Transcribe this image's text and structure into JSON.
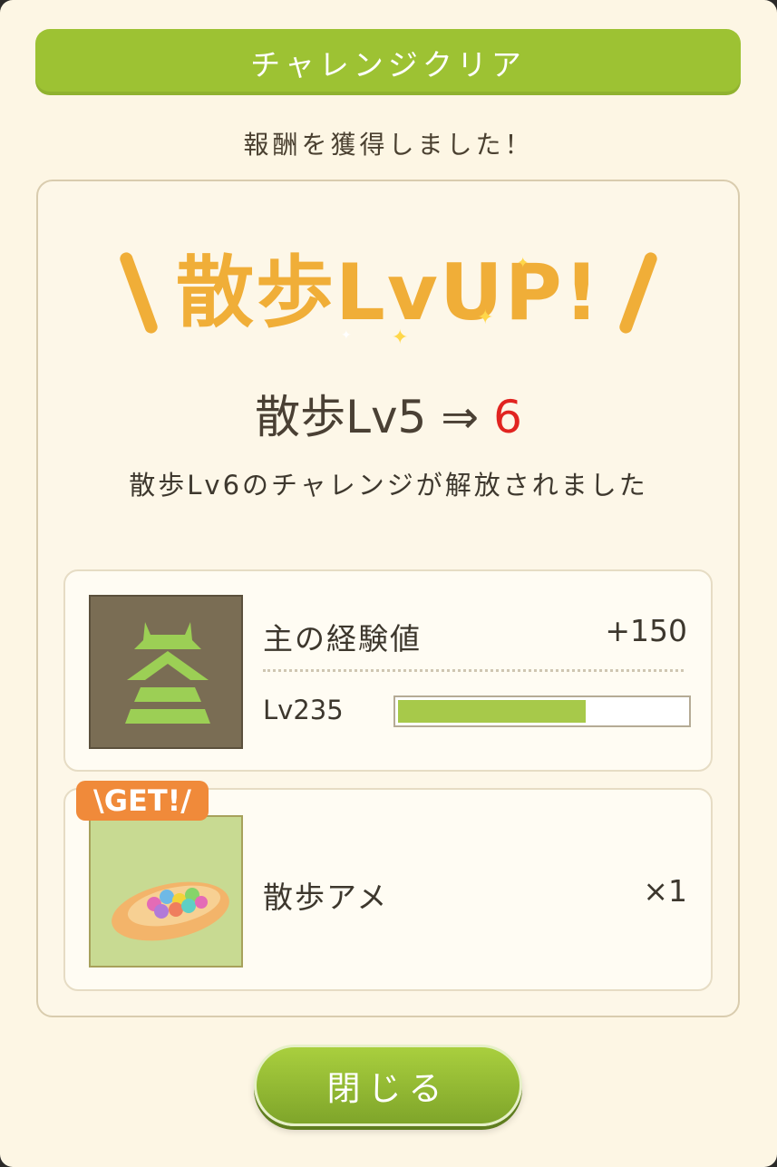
{
  "dialog": {
    "header_title": "チャレンジクリア",
    "subtitle": "報酬を獲得しました！"
  },
  "level_up": {
    "banner": "散歩LvUP!",
    "level_from_text": "散歩Lv5 ⇒ ",
    "level_to": "6",
    "unlock_message": "散歩Lv6のチャレンジが解放されました"
  },
  "rewards": {
    "exp": {
      "label": "主の経験値",
      "amount": "+150",
      "level": "Lv235",
      "progress": 0.65
    },
    "item": {
      "badge": "\\GET!/",
      "label": "散歩アメ",
      "quantity": "×1"
    }
  },
  "close_button_label": "閉じる",
  "colors": {
    "accent_green": "#9dc233",
    "banner_orange": "#f0ae38",
    "highlight_red": "#e12420"
  }
}
